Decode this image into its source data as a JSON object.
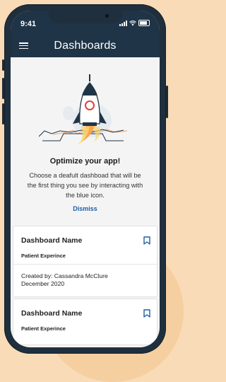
{
  "status_bar": {
    "time": "9:41"
  },
  "header": {
    "title": "Dashboards",
    "menu_icon": "hamburger-menu-icon"
  },
  "promo": {
    "illustration": "rocket-launch-illustration",
    "title": "Optimize your app!",
    "body": "Choose a deafult dashboad that will be the first thing you see by interacting with the blue icon.",
    "dismiss_label": "Dismiss"
  },
  "dashboards": [
    {
      "name": "Dashboard Name",
      "subtitle": "Patient Experince",
      "created_by": "Created by: Cassandra McClure",
      "date": "December 2020",
      "icon": "bookmark-icon"
    },
    {
      "name": "Dashboard Name",
      "subtitle": "Patient Experince",
      "icon": "bookmark-icon"
    }
  ],
  "colors": {
    "header_bg": "#1f3447",
    "accent": "#1c5ea8",
    "background": "#f9dbb7"
  }
}
